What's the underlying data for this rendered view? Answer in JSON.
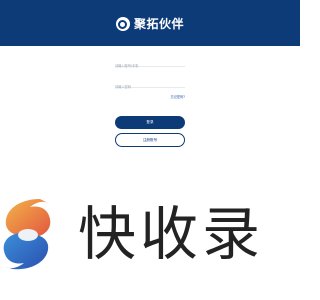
{
  "header": {
    "brand_name": "聚拓伙伴",
    "background_color": "#0d3b78",
    "logo_icon": "brand-logo-icon"
  },
  "form": {
    "account_placeholder": "请输入账号/手机",
    "password_placeholder": "请输入密码",
    "forgot_password_link": "忘记密码?",
    "login_button": "登录",
    "register_button": "注册账号"
  },
  "watermark": {
    "text": "快收录",
    "logo_icon": "s-swirl-logo-icon"
  }
}
